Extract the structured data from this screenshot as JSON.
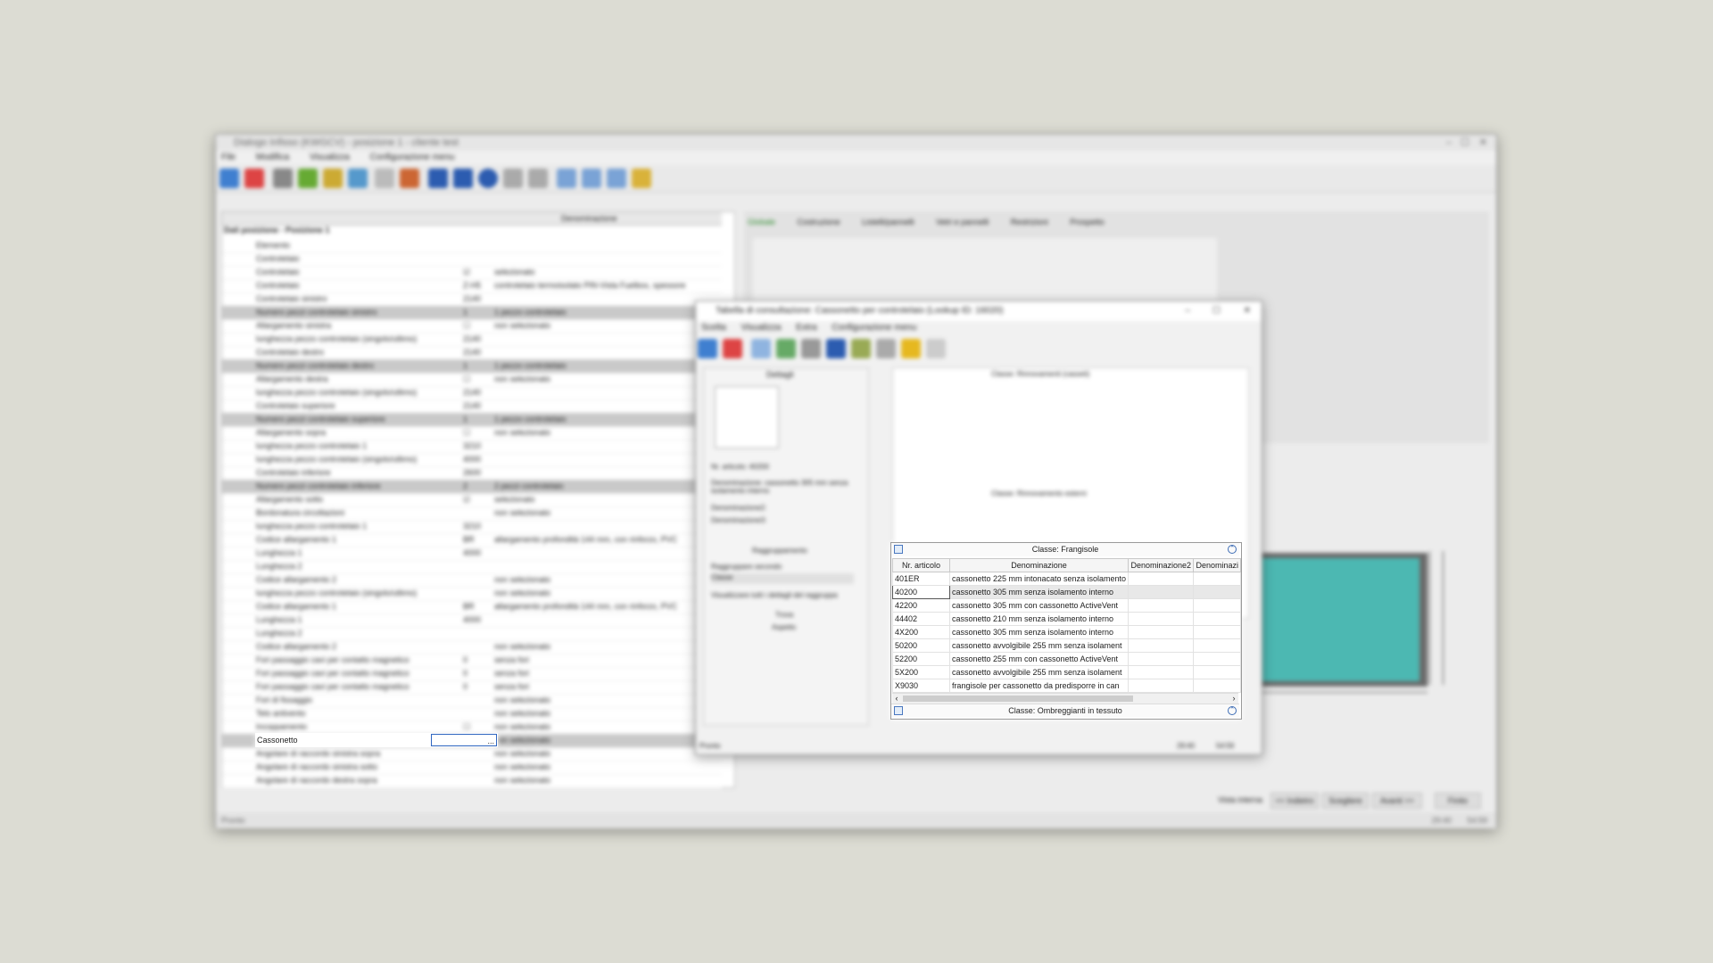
{
  "main": {
    "title": "Dialogo Infisso (KWGCV) - posizione 1 - cliente test",
    "menu": [
      "File",
      "Modifica",
      "Visualizza",
      "Configurazione menu"
    ],
    "tabs": [
      "Globale",
      "Costruzione",
      "Listelli/pannelli",
      "Vetri e pannelli",
      "Restrizioni",
      "Prospetto"
    ],
    "left_header": [
      "",
      "Denominazione"
    ],
    "section_title": "Dati posizione - Posizione 1",
    "rows": [
      {
        "label": "Elemento",
        "value": "",
        "desc": "",
        "group": false
      },
      {
        "label": "Controtelaio",
        "value": "",
        "desc": "",
        "group": false
      },
      {
        "label": "Controtelaio",
        "value": "☑",
        "desc": "selezionato",
        "group": false
      },
      {
        "label": "Controtelaio",
        "value": "Z-H5",
        "desc": "controtelaio termoisolato PIN-Vista Fuelbox, spessore",
        "group": false
      },
      {
        "label": "Controtelaio sinistro",
        "value": "2140",
        "desc": "",
        "group": false
      },
      {
        "label": "Numero pezzi controtelaio sinistro",
        "value": "1",
        "desc": "1 pezzo controtelaio",
        "group": true
      },
      {
        "label": "Allargamento sinistra",
        "value": "☐",
        "desc": "non selezionato",
        "group": false
      },
      {
        "label": "lunghezza pezzo controtelaio (singolo/ultimo)",
        "value": "2140",
        "desc": "",
        "group": false
      },
      {
        "label": "Controtelaio destro",
        "value": "2140",
        "desc": "",
        "group": false
      },
      {
        "label": "Numero pezzi controtelaio destro",
        "value": "1",
        "desc": "1 pezzo controtelaio",
        "group": true
      },
      {
        "label": "Allargamento destra",
        "value": "☐",
        "desc": "non selezionato",
        "group": false
      },
      {
        "label": "lunghezza pezzo controtelaio (singolo/ultimo)",
        "value": "2140",
        "desc": "",
        "group": false
      },
      {
        "label": "Controtelaio superiore",
        "value": "2140",
        "desc": "",
        "group": false
      },
      {
        "label": "Numero pezzi controtelaio superiore",
        "value": "1",
        "desc": "1 pezzo controtelaio",
        "group": true
      },
      {
        "label": "Allargamento sopra",
        "value": "☐",
        "desc": "non selezionato",
        "group": false
      },
      {
        "label": "lunghezza pezzo controtelaio 1",
        "value": "3210",
        "desc": "",
        "group": false
      },
      {
        "label": "lunghezza pezzo controtelaio (singolo/ultimo)",
        "value": "4000",
        "desc": "",
        "group": false
      },
      {
        "label": "Controtelaio inferiore",
        "value": "2600",
        "desc": "",
        "group": false
      },
      {
        "label": "Numero pezzi controtelaio inferiore",
        "value": "2",
        "desc": "2 pezzi controtelaio",
        "group": true
      },
      {
        "label": "Allargamento sotto",
        "value": "☑",
        "desc": "selezionato",
        "group": false
      },
      {
        "label": "Bordonatura circoltazioni",
        "value": "",
        "desc": "non selezionato",
        "group": false
      },
      {
        "label": "lunghezza pezzo controtelaio 1",
        "value": "3210",
        "desc": "",
        "group": false
      },
      {
        "label": "Codice allargamento 1",
        "value": "BR",
        "desc": "allargamento profondità 144 mm, con rinforzo, PVC",
        "group": false
      },
      {
        "label": "Lunghezza 1",
        "value": "4000",
        "desc": "",
        "group": false
      },
      {
        "label": "Lunghezza 2",
        "value": "",
        "desc": "",
        "group": false
      },
      {
        "label": "Codice allargamento 2",
        "value": "",
        "desc": "non selezionato",
        "group": false
      },
      {
        "label": "lunghezza pezzo controtelaio (singolo/ultimo)",
        "value": "",
        "desc": "non selezionato",
        "group": false
      },
      {
        "label": "Codice allargamento 1",
        "value": "BR",
        "desc": "allargamento profondità 144 mm, con rinforzo, PVC",
        "group": false
      },
      {
        "label": "Lunghezza 1",
        "value": "4000",
        "desc": "",
        "group": false
      },
      {
        "label": "Lunghezza 2",
        "value": "",
        "desc": "",
        "group": false
      },
      {
        "label": "Codice allargamento 2",
        "value": "",
        "desc": "non selezionato",
        "group": false
      },
      {
        "label": "Fori passaggio cavi per contatto magnetico",
        "value": "0",
        "desc": "senza fori",
        "group": false
      },
      {
        "label": "Fori passaggio cavi per contatto magnetico",
        "value": "0",
        "desc": "senza fori",
        "group": false
      },
      {
        "label": "Fori passaggio cavi per contatto magnetico",
        "value": "0",
        "desc": "senza fori",
        "group": false
      },
      {
        "label": "Fori di fissaggio",
        "value": "",
        "desc": "non selezionato",
        "group": false
      },
      {
        "label": "Telo antivento",
        "value": "",
        "desc": "non selezionato",
        "group": false
      },
      {
        "label": "Incoppamento",
        "value": "☐",
        "desc": "non selezionato",
        "group": false
      },
      {
        "label": "Cassonetto",
        "value": "",
        "desc": "non selezionato",
        "group": true
      },
      {
        "label": "Angolare di raccordo sinistra sopra",
        "value": "",
        "desc": "non selezionato",
        "group": false
      },
      {
        "label": "Angolare di raccordo sinistra sotto",
        "value": "",
        "desc": "non selezionato",
        "group": false
      },
      {
        "label": "Angolare di raccordo destra sopra",
        "value": "",
        "desc": "non selezionato",
        "group": false
      }
    ],
    "status": "Pronto",
    "bottom_buttons": [
      "Vista interna",
      "<< Indietro",
      "Scegliere",
      "Avanti >>",
      "Finito"
    ],
    "status_right": [
      "29:40",
      "54:59"
    ]
  },
  "lookup": {
    "title": "Tabella di consultazione: Cassonetto per controtelaio (Lookup ID: 16020)",
    "menu": [
      "Scelta",
      "Visualizza",
      "Extra",
      "Configurazione menu"
    ],
    "side_title": "Dettagli",
    "side_fields": [
      "Nr. articolo: 40200",
      "Denominazione: cassonetto 305 mm senza isolamento interno",
      "Denominazione2:",
      "Denominazione3:"
    ],
    "group_title": "Raggruppamento",
    "group_by": "Raggruppare secondo",
    "group_value": "Classe",
    "show_all": "Visualizzare tutti i dettagli del raggruppa",
    "filter_title": "Trova",
    "aspect_title": "Aspetto",
    "status": "Pronto",
    "status_right": [
      "29:40",
      "54:59"
    ],
    "class1": "Classe: Rinnovamenti (casseti)",
    "class2": "Classe: Rinnovamento esterni",
    "class3": "Classe: Frangisole",
    "class4": "Classe: Ombreggianti in tessuto",
    "columns": [
      "Nr. articolo",
      "Denominazione",
      "Denominazione2",
      "Denominazi"
    ],
    "rows": [
      {
        "art": "401ER",
        "den": "cassonetto 225 mm intonacato senza isolamento"
      },
      {
        "art": "40200",
        "den": "cassonetto 305 mm senza isolamento interno",
        "selected": true
      },
      {
        "art": "42200",
        "den": "cassonetto 305 mm con cassonetto ActiveVent"
      },
      {
        "art": "44402",
        "den": "cassonetto 210 mm senza isolamento interno"
      },
      {
        "art": "4X200",
        "den": "cassonetto 305 mm senza isolamento interno"
      },
      {
        "art": "50200",
        "den": "cassonetto avvolgibile 255 mm senza isolament"
      },
      {
        "art": "52200",
        "den": "cassonetto 255 mm con cassonetto ActiveVent"
      },
      {
        "art": "5X200",
        "den": "cassonetto avvolgibile 255 mm senza isolament"
      },
      {
        "art": "X9030",
        "den": "frangisole per cassonetto da predisporre in can"
      }
    ]
  },
  "field": {
    "label": "Cassonetto",
    "button": "..."
  },
  "colors": {
    "background": "#dcdcd3",
    "preview_glass": "#4cb8b2",
    "accent": "#2f66c0"
  }
}
